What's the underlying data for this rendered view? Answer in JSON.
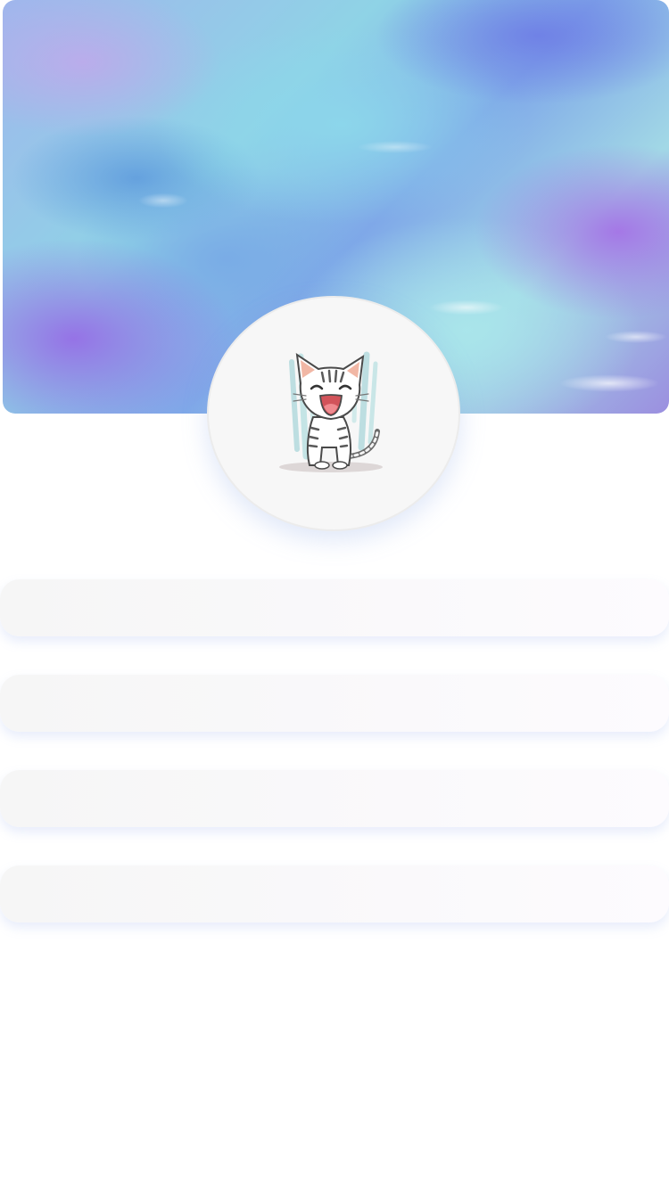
{
  "header": {
    "banner_style": "watercolor-blue-purple",
    "colors": {
      "blue": "#7fa8e8",
      "cyan": "#8fd3e6",
      "purple": "#9b8fe0"
    }
  },
  "profile": {
    "avatar_icon": "singing-kitten-icon"
  },
  "menu": {
    "items": [
      {
        "label": ""
      },
      {
        "label": ""
      },
      {
        "label": ""
      },
      {
        "label": ""
      }
    ]
  }
}
